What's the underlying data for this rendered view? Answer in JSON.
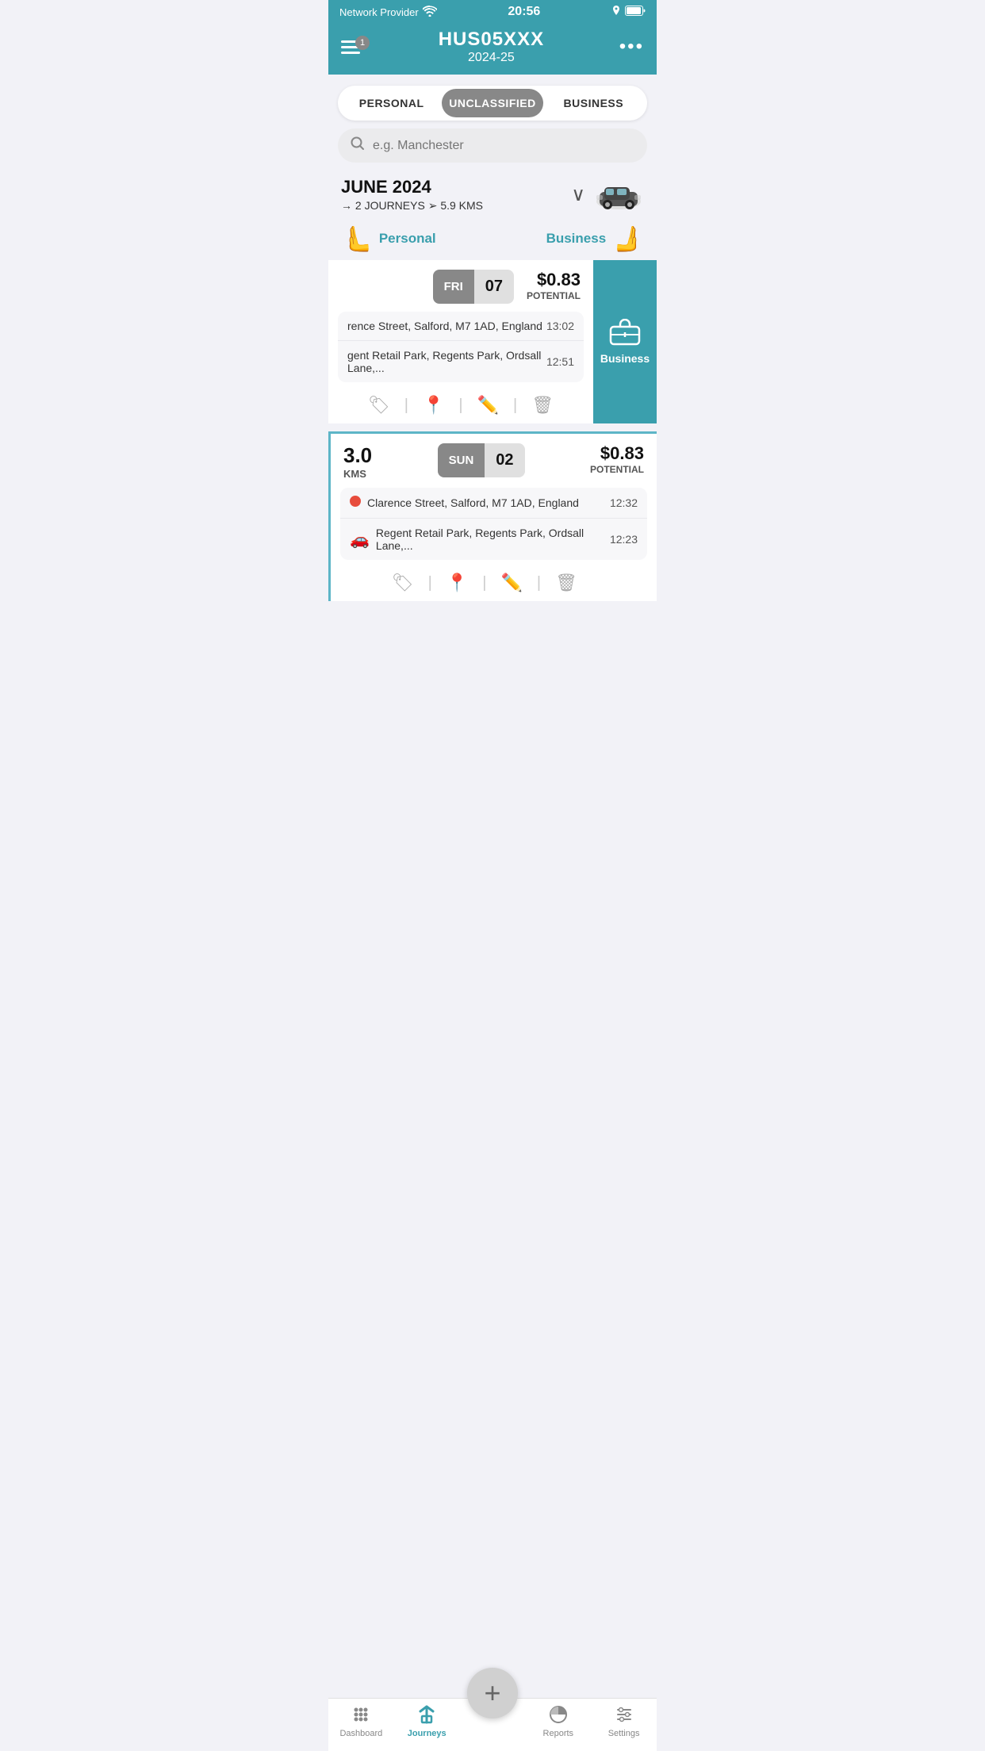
{
  "statusBar": {
    "network": "Network Provider",
    "time": "20:56",
    "wifi": "wifi",
    "location": "location",
    "battery": "battery"
  },
  "topNav": {
    "menuBadge": "1",
    "vehicleId": "HUS05XXX",
    "year": "2024-25",
    "dotsMenu": "•••"
  },
  "segmentControl": {
    "options": [
      "PERSONAL",
      "UNCLASSIFIED",
      "BUSINESS"
    ],
    "activeIndex": 1
  },
  "searchBar": {
    "placeholder": "e.g. Manchester"
  },
  "monthHeader": {
    "title": "JUNE 2024",
    "journeys": "2 JOURNEYS",
    "distance": "5.9 KMS",
    "arrow": "→",
    "distanceArrow": "➢"
  },
  "classificationRow": {
    "personalLabel": "Personal",
    "businessLabel": "Business"
  },
  "journeys": [
    {
      "id": "journey-1",
      "dayName": "FRI",
      "dayNum": "07",
      "potential": "$0.83",
      "potentialLabel": "POTENTIAL",
      "legs": [
        {
          "address": "rence Street, Salford, M7 1AD, England",
          "time": "13:02",
          "iconType": "none"
        },
        {
          "address": "gent Retail Park, Regents Park, Ordsall Lane,...",
          "time": "12:51",
          "iconType": "none"
        }
      ],
      "hasSidePanel": true,
      "sidePanelLabel": "Business"
    },
    {
      "id": "journey-2",
      "kms": "3.0",
      "kmsLabel": "KMS",
      "dayName": "SUN",
      "dayNum": "02",
      "potential": "$0.83",
      "potentialLabel": "POTENTIAL",
      "legs": [
        {
          "address": "Clarence Street, Salford, M7 1AD, England",
          "time": "12:32",
          "iconType": "dot"
        },
        {
          "address": "Regent Retail Park, Regents Park, Ordsall Lane,...",
          "time": "12:23",
          "iconType": "car"
        }
      ],
      "hasSidePanel": false
    }
  ],
  "actions": {
    "tag": "🏷",
    "pin": "📍",
    "edit": "✏",
    "trash": "🗑"
  },
  "bottomNav": {
    "items": [
      {
        "label": "Dashboard",
        "icon": "grid",
        "active": false
      },
      {
        "label": "Journeys",
        "icon": "road",
        "active": true
      },
      {
        "label": "",
        "icon": "plus",
        "isFab": true
      },
      {
        "label": "Reports",
        "icon": "pie",
        "active": false
      },
      {
        "label": "Settings",
        "icon": "sliders",
        "active": false
      }
    ]
  }
}
